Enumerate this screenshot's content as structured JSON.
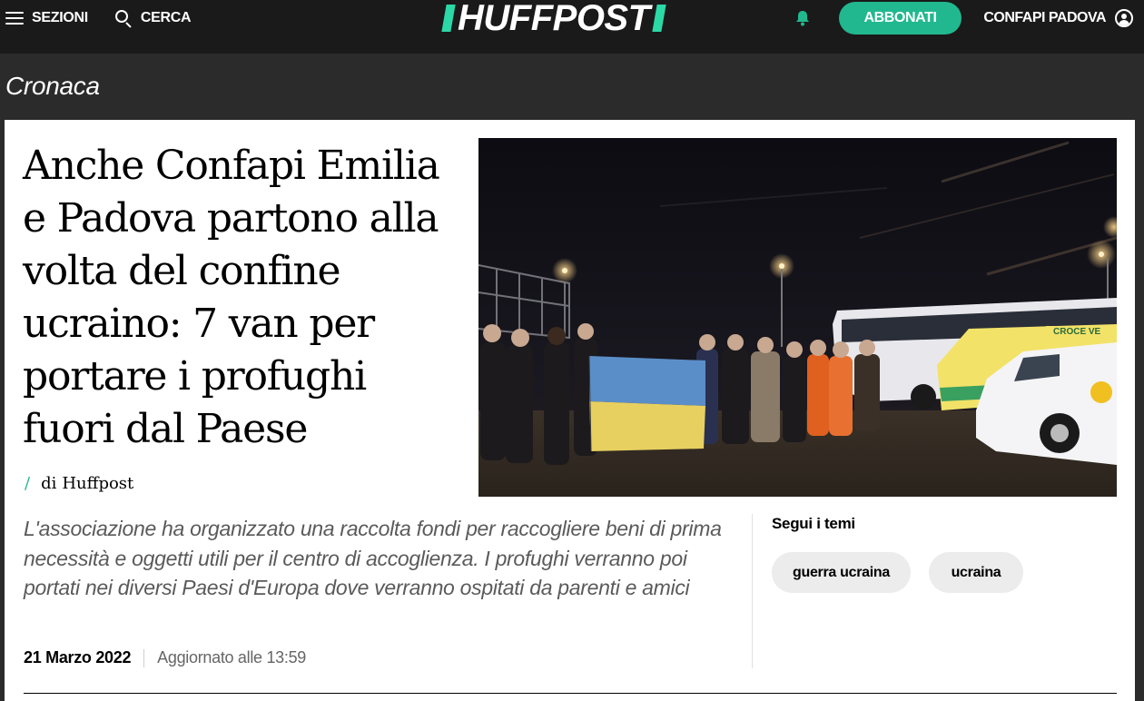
{
  "nav": {
    "sections_label": "SEZIONI",
    "search_label": "CERCA",
    "logo_text": "HUFFPOST",
    "subscribe_label": "ABBONATI",
    "account_label": "CONFAPI PADOVA"
  },
  "section": {
    "label": "Cronaca"
  },
  "article": {
    "headline": "Anche Confapi Emilia e Padova partono alla volta del confine ucraino: 7 van per portare i profughi fuori dal Paese",
    "byline_prefix": "di",
    "author": "Huffpost",
    "deck": "L'associazione ha organizzato una raccolta fondi per raccogliere beni di prima necessità e oggetti utili per il centro di accoglienza. I profughi verranno poi portati nei diversi Paesi d'Europa dove verranno ospitati da parenti e amici",
    "date": "21 Marzo 2022",
    "updated": "Aggiornato alle 13:59",
    "image": {
      "bus_text": "CROCE VE"
    }
  },
  "topics": {
    "title": "Segui i temi",
    "items": [
      "guerra ucraina",
      "ucraina"
    ]
  },
  "colors": {
    "accent": "#21b88f",
    "logo_accent": "#2bd9a6",
    "nav_bg": "#1a1a1a",
    "section_bg": "#2b2b2b"
  },
  "icons": [
    "hamburger-icon",
    "search-icon",
    "bell-icon",
    "user-icon"
  ]
}
